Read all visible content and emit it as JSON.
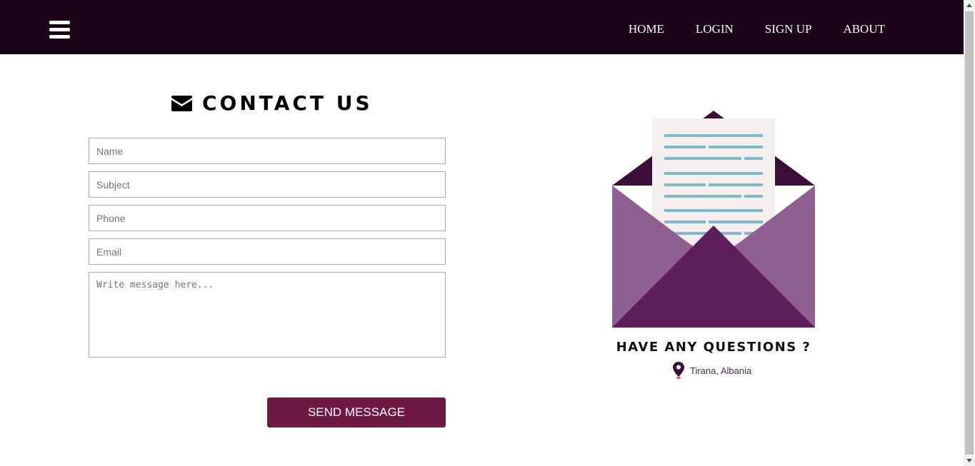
{
  "nav": {
    "links": [
      {
        "label": "HOME"
      },
      {
        "label": "LOGIN"
      },
      {
        "label": "SIGN UP"
      },
      {
        "label": "ABOUT"
      }
    ],
    "menu_icon": "hamburger-icon"
  },
  "contact": {
    "title": "CONTACT US",
    "title_icon": "envelope-icon",
    "fields": {
      "name_placeholder": "Name",
      "subject_placeholder": "Subject",
      "phone_placeholder": "Phone",
      "email_placeholder": "Email",
      "message_placeholder": "Write message here..."
    },
    "submit_label": "SEND MESSAGE"
  },
  "info": {
    "heading": "HAVE ANY QUESTIONS ?",
    "location": "Tirana, Albania",
    "location_icon": "map-pin-icon"
  },
  "colors": {
    "navbar": "#1c0418",
    "button": "#6e1942",
    "envelope_dark": "#3b0f37",
    "envelope_mid": "#8f5f92",
    "envelope_front": "#5f1e5c",
    "letter_lines": "#7fb8cc"
  }
}
